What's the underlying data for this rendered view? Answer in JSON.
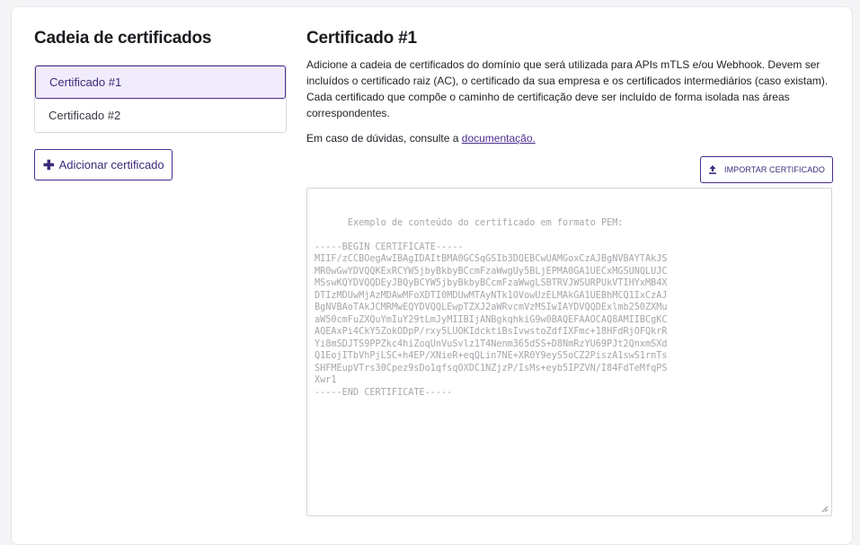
{
  "sidebar": {
    "title": "Cadeia de certificados",
    "items": [
      {
        "label": "Certificado #1",
        "active": true
      },
      {
        "label": "Certificado #2",
        "active": false
      }
    ],
    "add_button": {
      "label": "Adicionar certificado",
      "icon": "plus-icon"
    }
  },
  "main": {
    "title": "Certificado #1",
    "description": "Adicione a cadeia de certificados do domínio que será utilizada para APIs mTLS e/ou Webhook. Devem ser incluídos o certificado raiz (AC), o certificado da sua empresa e os certificados intermediários (caso existam). Cada certificado que compõe o caminho de certificação deve ser incluído de forma isolada nas áreas correspondentes.",
    "help_prefix": "Em caso de dúvidas, consulte a ",
    "help_link": "documentação.",
    "import_button": {
      "label": "IMPORTAR CERTIFICADO",
      "icon": "upload-icon"
    },
    "textarea_placeholder": "Exemplo de conteúdo do certificado em formato PEM:\n\n-----BEGIN CERTIFICATE-----\nMIIF/zCCBOegAwIBAgIDAItBMA0GCSqGSIb3DQEBCwUAMGoxCzAJBgNVBAYTAkJS\nMR0wGwYDVQQKExRCYW5jbyBkbyBCcmFzaWwgUy5BLjEPMA0GA1UECxMGSUNQLUJC\nMSswKQYDVQQDEyJBQyBCYW5jbyBkbyBCcmFzaWwgLSBTRVJWSURPUkVTIHYxMB4X\nDTIzMDUwMjAzMDAwMFoXDTI0MDUwMTAyNTk1OVowUzELMAkGA1UEBhMCQ1IxCzAJ\nBgNVBAoTAkJCMRMwEQYDVQQLEwpTZXJ2aWRvcmVzMSIwIAYDVQQDExlmb250ZXMu\naW50cmFuZXQuYmIuY29tLmJyMIIBIjANBgkqhkiG9w0BAQEFAAOCAQ8AMIIBCgKC\nAQEAxPi4CkY5ZokODpP/rxy5LUOKIdcktiBsIvwstoZdfIXFmc+18HFdRjOFQkrR\nYi8mSDJTS9PPZkc4hiZoqUnVuSvlz1T4Nenm365dSS+D8NmRzYU69PJt2QnxmSXd\nQ1EojITbVhPjLSC+h4EP/XNieR+eqQLin7NE+XR0Y9eyS5oCZ2PiszA1swS1rnTs\nSHFMEupVTrs30Cpez9sDo1qfsqOXDC1NZjzP/IsMs+eyb5IPZVN/I84FdTeMfqPS\nXwr1\n-----END CERTIFICATE-----"
  },
  "colors": {
    "accent": "#4b2c8f",
    "active_bg": "#f0ecfb"
  }
}
